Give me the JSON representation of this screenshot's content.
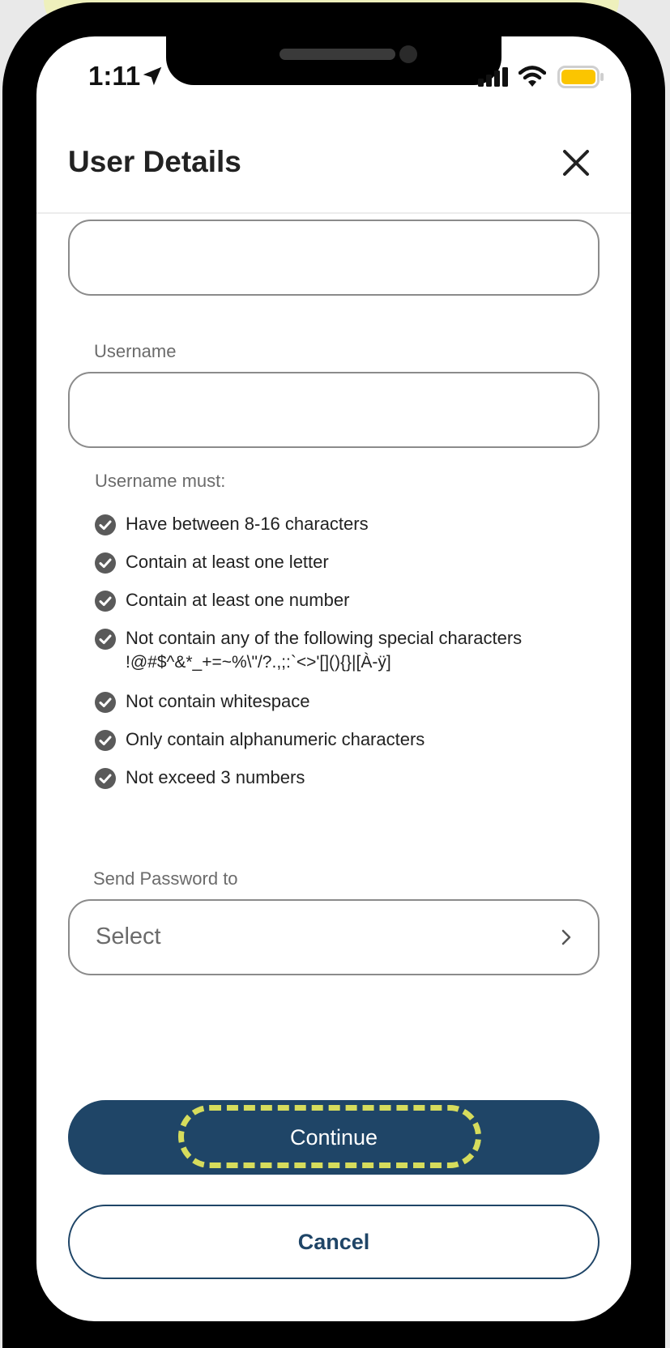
{
  "status_bar": {
    "time": "1:11",
    "battery_color": "#fbc500"
  },
  "header": {
    "title": "User Details"
  },
  "form": {
    "first_field_value": "",
    "username_label": "Username",
    "username_value": "",
    "rules_heading": "Username must:",
    "rules": [
      "Have between 8-16 characters",
      "Contain at least one letter",
      "Contain at least one number",
      "Not contain any of the following special characters",
      "Not contain whitespace",
      "Only contain alphanumeric characters",
      "Not exceed 3 numbers"
    ],
    "special_chars": "!@#$^&*_+=~%\\\"/?.,;:`<>'[](){}|[À-ÿ]",
    "send_password_label": "Send Password to",
    "send_password_value": "Select"
  },
  "buttons": {
    "continue": "Continue",
    "cancel": "Cancel"
  },
  "colors": {
    "primary": "#1f4567",
    "check": "#5a5a5a",
    "highlight": "#d6dc5c"
  }
}
